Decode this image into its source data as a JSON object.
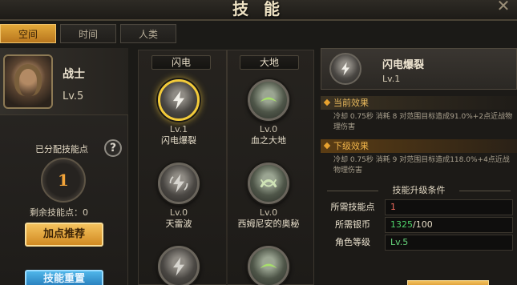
{
  "window": {
    "title": "技 能",
    "close_icon": "close-icon"
  },
  "tabs": [
    {
      "label": "空间",
      "active": true
    },
    {
      "label": "时间",
      "active": false
    },
    {
      "label": "人类",
      "active": false
    }
  ],
  "hero": {
    "name": "战士",
    "level": "Lv.5",
    "assigned_points_label": "已分配技能点",
    "assigned_points": "1",
    "remaining_label": "剩余技能点：0",
    "recommend_button": "加点推荐",
    "reset_button": "技能重置"
  },
  "tree": {
    "columns": [
      "闪电",
      "大地"
    ],
    "skills": [
      {
        "level": "Lv.1",
        "name": "闪电爆裂",
        "icon": "lightning-icon",
        "selected": true
      },
      {
        "level": "Lv.0",
        "name": "血之大地",
        "icon": "earth-wave-icon",
        "selected": false
      },
      {
        "level": "Lv.0",
        "name": "天雷波",
        "icon": "lightning-icon",
        "selected": false
      },
      {
        "level": "Lv.0",
        "name": "西姆尼安的奥秘",
        "icon": "earth-arc-icon",
        "selected": false
      }
    ]
  },
  "detail": {
    "name": "闪电爆裂",
    "level": "Lv.1",
    "current_label": "当前效果",
    "current_text": "冷却 0.75秒 消耗 8 对范围目标造成91.0%+2点近战物理伤害",
    "next_label": "下级效果",
    "next_text": "冷却 0.75秒 消耗 9 对范围目标造成118.0%+4点近战物理伤害",
    "conditions_title": "技能升级条件",
    "conditions": [
      {
        "label": "所需技能点",
        "value": "1"
      },
      {
        "label": "所需银币",
        "value_ok": "1325",
        "value_rest": "/100"
      },
      {
        "label": "角色等级",
        "value": "Lv.5"
      }
    ]
  },
  "colors": {
    "accent": "#e3a93a",
    "selected_ring": "#f3cb3a",
    "reset_blue": "#2479b8"
  }
}
